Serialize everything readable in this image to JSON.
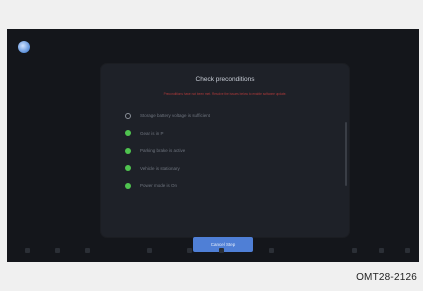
{
  "dialog": {
    "title": "Check preconditions",
    "warning": "Preconditions have not been met. Resolve the issues below to enable software update.",
    "items": [
      {
        "label": "Storage battery voltage is sufficient",
        "status": "pending"
      },
      {
        "label": "Gear is in P",
        "status": "ok"
      },
      {
        "label": "Parking brake is active",
        "status": "ok"
      },
      {
        "label": "Vehicle is stationary",
        "status": "ok"
      },
      {
        "label": "Power mode is On",
        "status": "ok"
      }
    ],
    "cancel_label": "Cancel Step"
  },
  "caption": "OMT28-2126",
  "colors": {
    "ok": "#4fc34f",
    "accent": "#4f7fd6",
    "warning": "#b03a3a",
    "screen_bg": "#14161b"
  },
  "dock_icons": [
    "home-icon",
    "grid-icon",
    "phone-icon",
    "media-icon",
    "fan-icon",
    "temperature-icon",
    "seat-icon",
    "settings-icon",
    "volume-icon",
    "profile-icon"
  ]
}
